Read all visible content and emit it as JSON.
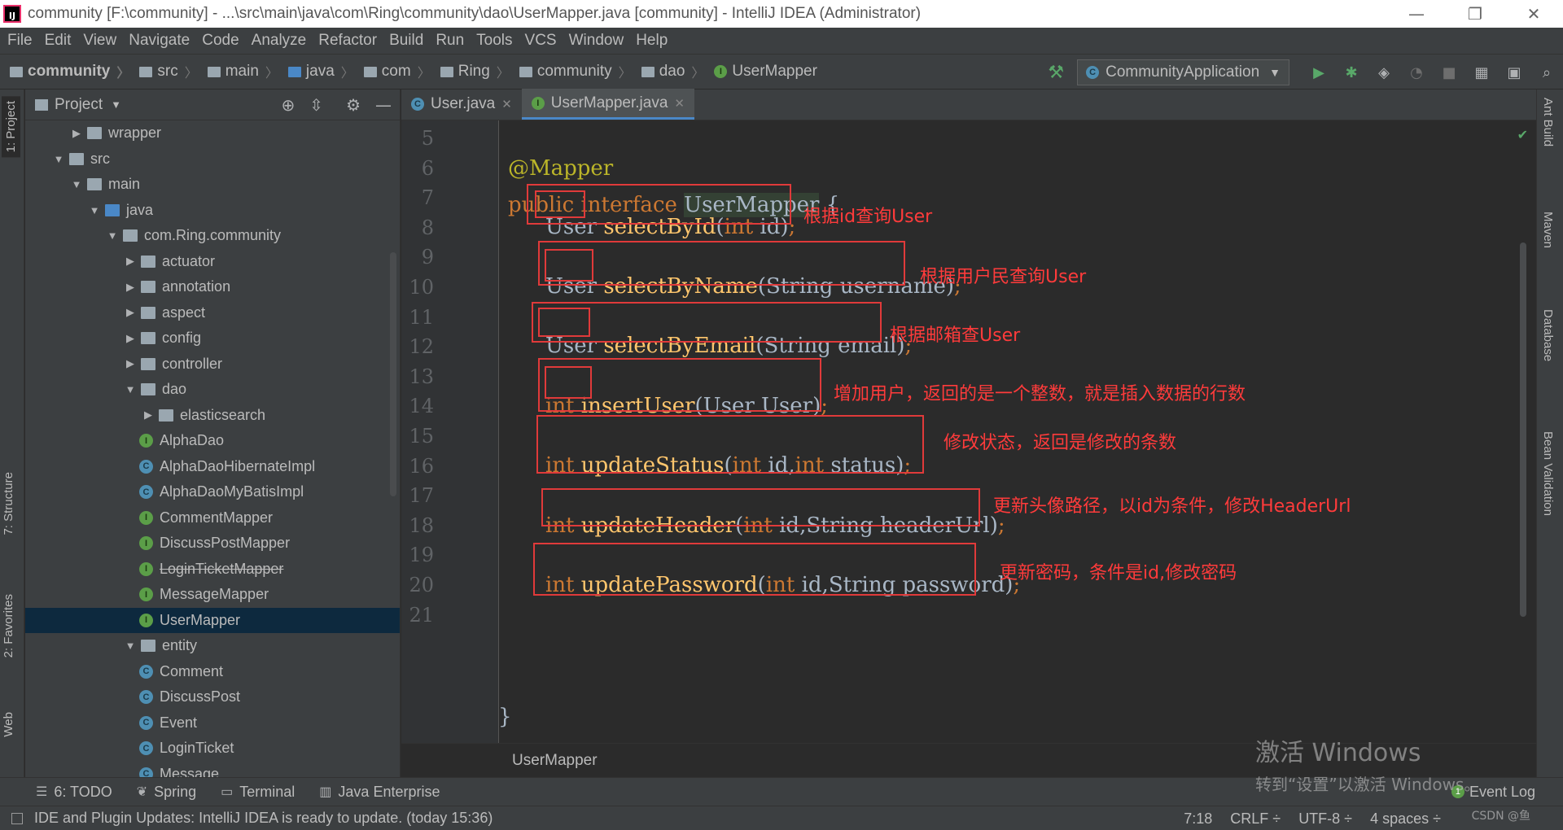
{
  "window": {
    "title": "community [F:\\community] - ...\\src\\main\\java\\com\\Ring\\community\\dao\\UserMapper.java [community] - IntelliJ IDEA (Administrator)",
    "minimize": "—",
    "restore": "❐",
    "close": "✕"
  },
  "menu": [
    "File",
    "Edit",
    "View",
    "Navigate",
    "Code",
    "Analyze",
    "Refactor",
    "Build",
    "Run",
    "Tools",
    "VCS",
    "Window",
    "Help"
  ],
  "breadcrumb": [
    "community",
    "src",
    "main",
    "java",
    "com",
    "Ring",
    "community",
    "dao",
    "UserMapper"
  ],
  "run_config": "CommunityApplication",
  "left_stripe": {
    "project": "1: Project",
    "structure": "7: Structure",
    "favorites": "2: Favorites",
    "web": "Web"
  },
  "project_panel": {
    "title": "Project",
    "tree": [
      {
        "label": "wrapper",
        "type": "folder",
        "depth": 2,
        "expanded": false
      },
      {
        "label": "src",
        "type": "folder",
        "depth": 1,
        "expanded": true
      },
      {
        "label": "main",
        "type": "folder",
        "depth": 2,
        "expanded": true
      },
      {
        "label": "java",
        "type": "folder-blue",
        "depth": 3,
        "expanded": true
      },
      {
        "label": "com.Ring.community",
        "type": "package",
        "depth": 4,
        "expanded": true
      },
      {
        "label": "actuator",
        "type": "package",
        "depth": 5,
        "expanded": false
      },
      {
        "label": "annotation",
        "type": "package",
        "depth": 5,
        "expanded": false
      },
      {
        "label": "aspect",
        "type": "package",
        "depth": 5,
        "expanded": false
      },
      {
        "label": "config",
        "type": "package",
        "depth": 5,
        "expanded": false
      },
      {
        "label": "controller",
        "type": "package",
        "depth": 5,
        "expanded": false
      },
      {
        "label": "dao",
        "type": "package",
        "depth": 5,
        "expanded": true
      },
      {
        "label": "elasticsearch",
        "type": "package",
        "depth": 6,
        "expanded": false
      },
      {
        "label": "AlphaDao",
        "type": "interface",
        "depth": 7
      },
      {
        "label": "AlphaDaoHibernateImpl",
        "type": "class",
        "depth": 7
      },
      {
        "label": "AlphaDaoMyBatisImpl",
        "type": "class",
        "depth": 7
      },
      {
        "label": "CommentMapper",
        "type": "interface",
        "depth": 7
      },
      {
        "label": "DiscussPostMapper",
        "type": "interface",
        "depth": 7
      },
      {
        "label": "LoginTicketMapper",
        "type": "interface",
        "depth": 7,
        "deprecated": true
      },
      {
        "label": "MessageMapper",
        "type": "interface",
        "depth": 7
      },
      {
        "label": "UserMapper",
        "type": "interface",
        "depth": 7,
        "selected": true
      },
      {
        "label": "entity",
        "type": "package",
        "depth": 5,
        "expanded": true
      },
      {
        "label": "Comment",
        "type": "class",
        "depth": 7
      },
      {
        "label": "DiscussPost",
        "type": "class",
        "depth": 7
      },
      {
        "label": "Event",
        "type": "class",
        "depth": 7
      },
      {
        "label": "LoginTicket",
        "type": "class",
        "depth": 7
      },
      {
        "label": "Message",
        "type": "class",
        "depth": 7
      }
    ]
  },
  "tabs": [
    {
      "label": "User.java",
      "kind": "class",
      "active": false
    },
    {
      "label": "UserMapper.java",
      "kind": "interface",
      "active": true
    }
  ],
  "code": {
    "line_numbers": [
      "5",
      "6",
      "7",
      "8",
      "9",
      "10",
      "11",
      "12",
      "13",
      "14",
      "15",
      "16",
      "17",
      "18",
      "19",
      "20",
      "21"
    ],
    "annotation": "@Mapper",
    "decl_kw": "public interface",
    "decl_name": "UserMapper",
    "decl_brace": " {",
    "closing": "}",
    "methods": [
      {
        "ret": "User",
        "name": "selectById",
        "params_kw": "int",
        "params_rest": " id",
        "params_extra": "",
        "note": "根据id查询User"
      },
      {
        "ret": "User",
        "name": "selectByName",
        "params_kw": "",
        "params_rest": "String username",
        "params_extra": "",
        "note": "根据用户民查询User"
      },
      {
        "ret": "User",
        "name": "selectByEmail",
        "params_kw": "",
        "params_rest": "String email",
        "params_extra": "",
        "note": "根据邮箱查User"
      },
      {
        "ret": "int",
        "name": "insertUser",
        "params_kw": "",
        "params_rest": "User User",
        "params_extra": "",
        "note": "增加用户，返回的是一个整数，就是插入数据的行数"
      },
      {
        "ret": "int",
        "name": "updateStatus",
        "params_kw": "int",
        "params_rest": " id,",
        "params_extra": "int status",
        "note": "修改状态，返回是修改的条数"
      },
      {
        "ret": "int",
        "name": "updateHeader",
        "params_kw": "int",
        "params_rest": " id,String headerUrl",
        "params_extra": "",
        "note": "更新头像路径，以id为条件，修改HeaderUrl"
      },
      {
        "ret": "int",
        "name": "updatePassword",
        "params_kw": "int",
        "params_rest": " id,String password",
        "params_extra": "",
        "note": "更新密码，条件是id,修改密码"
      }
    ]
  },
  "editor_breadcrumb": "UserMapper",
  "right_stripe": [
    "Ant Build",
    "Maven",
    "Database",
    "Bean Validation"
  ],
  "bottom_tools": [
    "6: TODO",
    "Spring",
    "Terminal",
    "Java Enterprise"
  ],
  "event_log": "Event Log",
  "status": {
    "message": "IDE and Plugin Updates: IntelliJ IDEA is ready to update. (today 15:36)",
    "position": "7:18",
    "line_sep": "CRLF ÷",
    "encoding": "UTF-8 ÷",
    "indent": "4 spaces ÷"
  },
  "watermark": {
    "line1": "激活 Windows",
    "line2": "转到“设置”以激活 Windows。",
    "csdn": "CSDN @鱼"
  },
  "colors": {
    "keyword": "#cc7832",
    "function": "#ffc66d",
    "annotation": "#bbb529",
    "note_red": "#ff3b3b",
    "box_red": "#e03a3a"
  }
}
